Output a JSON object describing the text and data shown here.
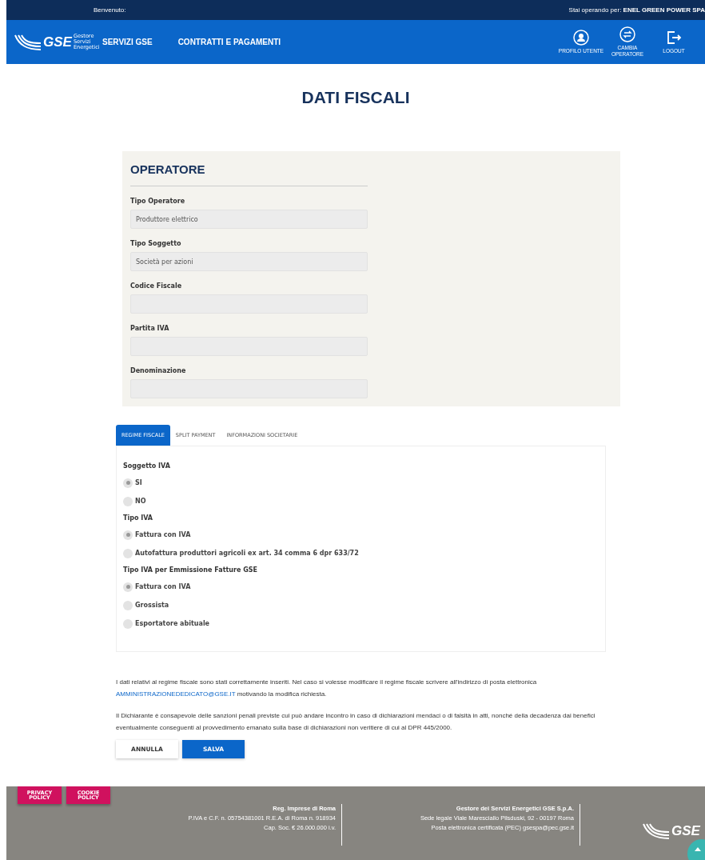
{
  "top_bar": {
    "welcome": "Benvenuto:",
    "operating_as": "Stai operando per: **ENEL GREEN POWER SPA**"
  },
  "logo": {
    "name": "GSE",
    "tagline": "Gestore Servizi Energetici"
  },
  "nav": [
    {
      "label": "SERVIZI GSE"
    },
    {
      "label": "CONTRATTI E PAGAMENTI"
    }
  ],
  "nav_actions": [
    {
      "kind": "user",
      "label": "PROFILO UTENTE"
    },
    {
      "kind": "switch",
      "label": "CAMBIA OPERATORE"
    },
    {
      "kind": "logout",
      "label": "LOGOUT"
    }
  ],
  "page_title": "DATI FISCALI",
  "operator": {
    "title": "OPERATORE",
    "fields": [
      {
        "label": "Tipo Operatore",
        "value": "Produttore elettrico"
      },
      {
        "label": "Tipo Soggetto",
        "value": "Società per azioni"
      },
      {
        "label": "Codice Fiscale"
      },
      {
        "label": "Partita IVA"
      },
      {
        "label": "Denominazione"
      }
    ]
  },
  "tabs": [
    {
      "label": "REGIME FISCALE",
      "selected": true
    },
    {
      "label": "SPLIT PAYMENT",
      "selected": false
    },
    {
      "label": "INFORMAZIONI SOCIETARIE",
      "selected": false
    }
  ],
  "radio_groups": [
    {
      "label": "Soggetto IVA",
      "options": [
        {
          "label": "SI",
          "selected": true
        },
        {
          "label": "NO",
          "selected": false
        }
      ]
    },
    {
      "label": "Tipo IVA",
      "options": [
        {
          "label": "Fattura con IVA",
          "selected": true
        },
        {
          "label": "Autofattura produttori agricoli ex art. 34 comma 6 dpr 633/72",
          "selected": false
        }
      ]
    },
    {
      "label": "Tipo IVA per Emmissione Fatture GSE",
      "options": [
        {
          "label": "Fattura con IVA",
          "selected": true
        },
        {
          "label": "Grossista",
          "selected": false
        },
        {
          "label": "Esportatore abituale",
          "selected": false
        }
      ]
    }
  ],
  "notice": {
    "before": "I dati relativi al regime fiscale sono stati correttamente inseriti. Nel caso si volesse modificare il regime fiscale scrivere all'indirizzo di posta elettronica",
    "link": "AMMINISTRAZIONEDEDICATO@GSE.IT",
    "after": "motivando la modifica richiesta."
  },
  "declaration": "Il Dichiarante è consapevole delle sanzioni penali previste cui può andare incontro in caso di dichiarazioni mendaci o di falsità in atti, nonché della decadenza dai benefici eventualmente conseguenti al provvedimento emanato sulla base di dichiarazioni non veritiere di cui al DPR 445/2000.",
  "buttons": [
    {
      "kind": "secondary",
      "label": "ANNULLA"
    },
    {
      "kind": "primary",
      "label": "SALVA"
    }
  ],
  "footer": {
    "logo": "GSE",
    "policy_links": [
      "PRIVACY POLICY",
      "COOKIE POLICY"
    ],
    "columns": [
      {
        "title": "Reg. Imprese di Roma",
        "lines": [
          "P.IVA e C.F. n. 05754381001 R.E.A. di Roma n. 918934",
          "Cap. Soc. € 26.000.000 i.v."
        ]
      },
      {
        "title": "Gestore dei Servizi Energetici GSE S.p.A.",
        "lines": [
          "Sede legale Viale Maresciallo Pilsduski, 92 - 00197 Roma",
          "Posta elettronica certificata (PEC) gsespa@pec.gse.it"
        ]
      }
    ]
  }
}
